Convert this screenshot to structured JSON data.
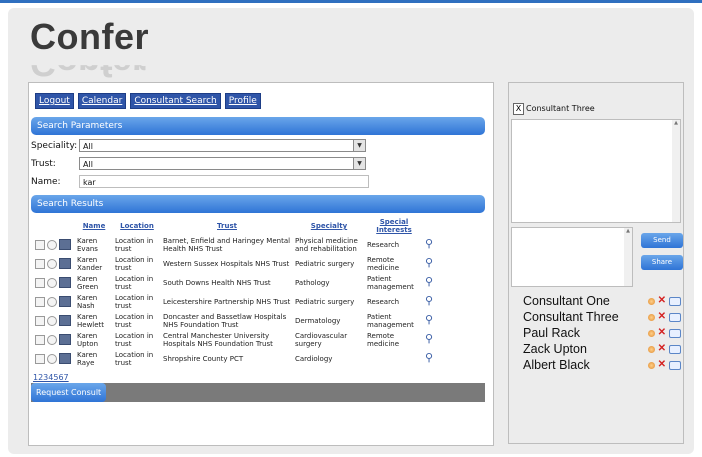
{
  "app": {
    "logo_text": "Confer"
  },
  "nav": [
    "Logout",
    "Calendar",
    "Consultant Search",
    "Profile"
  ],
  "search_params": {
    "title": "Search Parameters",
    "speciality_label": "Speciality:",
    "speciality_value": "All",
    "trust_label": "Trust:",
    "trust_value": "All",
    "name_label": "Name:",
    "name_value": "kar"
  },
  "results": {
    "title": "Search Results",
    "columns": [
      "Name",
      "Location",
      "Trust",
      "Specialty",
      "Special Interests"
    ],
    "rows": [
      {
        "name": "Karen Evans",
        "location": "Location in trust",
        "trust": "Barnet, Enfield and Haringey Mental Health NHS Trust",
        "specialty": "Physical medicine and rehabilitation",
        "interests": "Research"
      },
      {
        "name": "Karen Xander",
        "location": "Location in trust",
        "trust": "Western Sussex Hospitals NHS Trust",
        "specialty": "Pediatric surgery",
        "interests": "Remote medicine"
      },
      {
        "name": "Karen Green",
        "location": "Location in trust",
        "trust": "South Downs Health NHS Trust",
        "specialty": "Pathology",
        "interests": "Patient management"
      },
      {
        "name": "Karen Nash",
        "location": "Location in trust",
        "trust": "Leicestershire Partnership NHS Trust",
        "specialty": "Pediatric surgery",
        "interests": "Research"
      },
      {
        "name": "Karen Hewlett",
        "location": "Location in trust",
        "trust": "Doncaster and Bassetlaw Hospitals NHS Foundation Trust",
        "specialty": "Dermatology",
        "interests": "Patient management"
      },
      {
        "name": "Karen Upton",
        "location": "Location in trust",
        "trust": "Central Manchester University Hospitals NHS Foundation Trust",
        "specialty": "Cardiovascular surgery",
        "interests": "Remote medicine"
      },
      {
        "name": "Karen Raye",
        "location": "Location in trust",
        "trust": "Shropshire County PCT",
        "specialty": "Cardiology",
        "interests": ""
      }
    ],
    "pagination": "1234567",
    "request_button": "Request Consult"
  },
  "chat": {
    "close_label": "X",
    "title": "Consultant Three",
    "send_label": "Send",
    "share_label": "Share"
  },
  "consultants": [
    "Consultant One",
    "Consultant Three",
    "Paul Rack",
    "Zack Upton",
    "Albert Black"
  ]
}
